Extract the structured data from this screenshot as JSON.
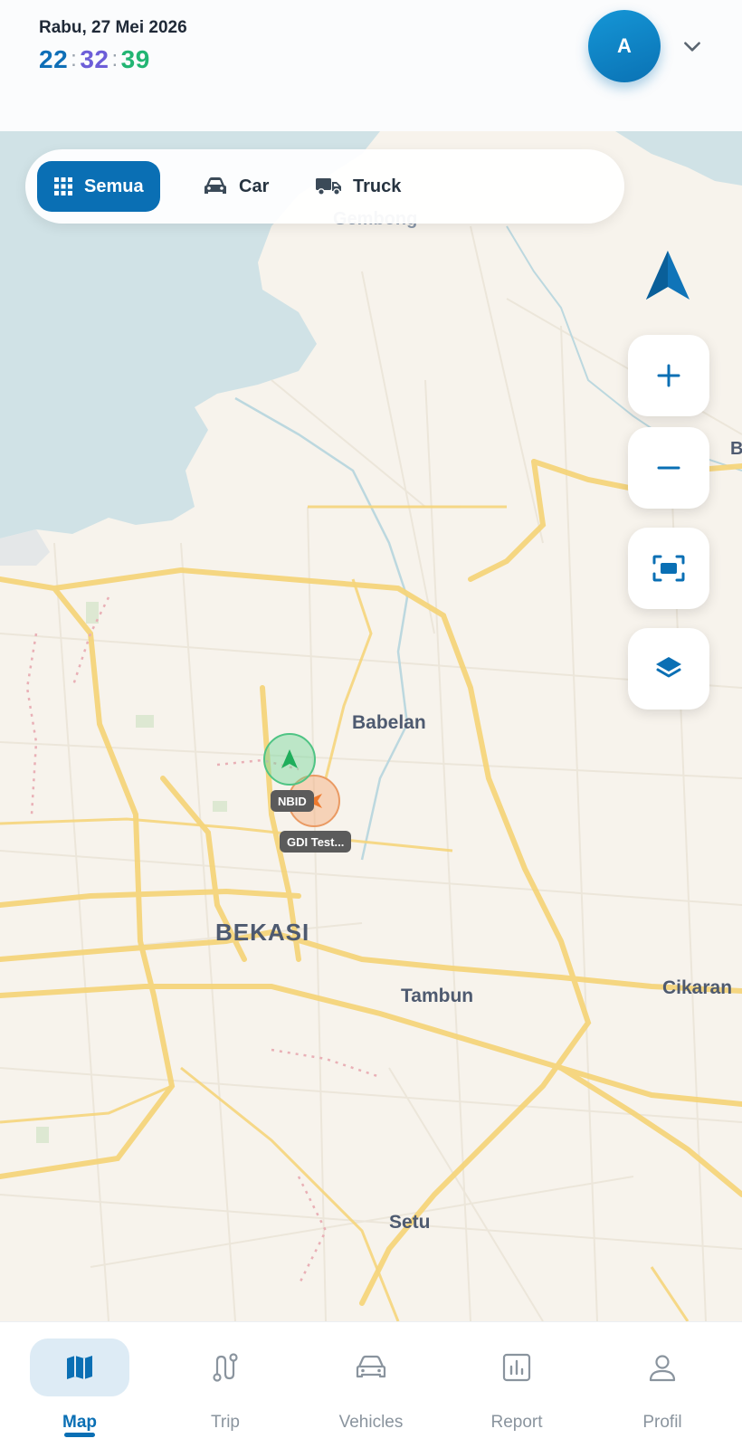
{
  "header": {
    "date": "Rabu, 27 Mei 2026",
    "time": {
      "hours": "22",
      "minutes": "32",
      "seconds": "39",
      "separator": ":"
    },
    "avatar_initial": "A"
  },
  "filters": [
    {
      "label": "Semua",
      "icon": "grid-icon",
      "active": true
    },
    {
      "label": "Car",
      "icon": "car-icon",
      "active": false
    },
    {
      "label": "Truck",
      "icon": "truck-icon",
      "active": false
    }
  ],
  "map": {
    "labels": {
      "gembong": "Gembong",
      "babelan": "Babelan",
      "bekasi": "BEKASI",
      "tambun": "Tambun",
      "cikarang": "Cikaran",
      "setu": "Setu",
      "edge_b": "B"
    },
    "vehicles": [
      {
        "name": "NBID",
        "status_color": "#4fc484",
        "icon": "navigation-arrow-icon"
      },
      {
        "name": "GDI Test...",
        "status_color": "#ea9a63",
        "icon": "navigation-arrow-icon"
      }
    ],
    "controls": [
      "compass-icon",
      "zoom-in-icon",
      "zoom-out-icon",
      "fit-bounds-icon",
      "layers-icon"
    ]
  },
  "nav": {
    "items": [
      {
        "label": "Map",
        "icon": "map-icon",
        "active": true
      },
      {
        "label": "Trip",
        "icon": "route-icon",
        "active": false
      },
      {
        "label": "Vehicles",
        "icon": "car-icon",
        "active": false
      },
      {
        "label": "Report",
        "icon": "chart-icon",
        "active": false
      },
      {
        "label": "Profil",
        "icon": "user-icon",
        "active": false
      }
    ]
  },
  "colors": {
    "primary": "#0a6fb4",
    "clock_hours": "#0f6fb7",
    "clock_minutes": "#6d5ed8",
    "clock_seconds": "#22b573",
    "water": "#cfe2e6",
    "land": "#f7f3ec",
    "road_major": "#f6d47a"
  }
}
